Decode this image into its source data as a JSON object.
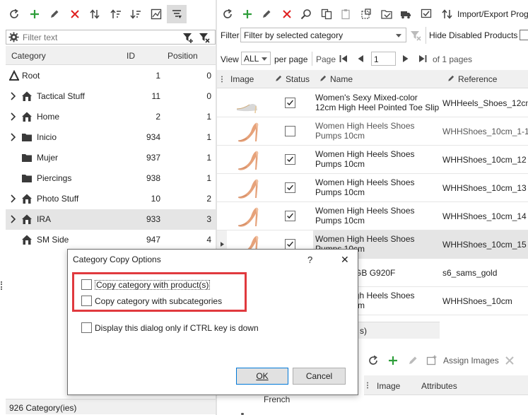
{
  "left_panel": {
    "filter_placeholder": "Filter text",
    "columns": {
      "category": "Category",
      "id": "ID",
      "position": "Position"
    },
    "rows": [
      {
        "name": "Root",
        "id": "1",
        "position": "0"
      },
      {
        "name": "Tactical Stuff",
        "id": "11",
        "position": "0"
      },
      {
        "name": "Home",
        "id": "2",
        "position": "1"
      },
      {
        "name": "Inicio",
        "id": "934",
        "position": "1"
      },
      {
        "name": "Mujer",
        "id": "937",
        "position": "1"
      },
      {
        "name": "Piercings",
        "id": "938",
        "position": "1"
      },
      {
        "name": "Photo Stuff",
        "id": "10",
        "position": "2"
      },
      {
        "name": "IRA",
        "id": "933",
        "position": "3"
      },
      {
        "name": "SM Side",
        "id": "947",
        "position": "4"
      }
    ],
    "status": "926 Category(ies)"
  },
  "right_toolbar": {
    "import_export_label": "Import/Export Prog"
  },
  "filter_bar": {
    "filter_label": "Filter",
    "filter_value": "Filter by selected category",
    "hide_disabled_label": "Hide Disabled Products"
  },
  "pager": {
    "view_label": "View",
    "view_value": "ALL",
    "per_page_label": "per page",
    "page_label": "Page",
    "page_value": "1",
    "of_pages": "of 1 pages"
  },
  "products": {
    "columns": {
      "image": "Image",
      "status": "Status",
      "name": "Name",
      "reference": "Reference"
    },
    "rows": [
      {
        "name": "Women's Sexy Mixed-color 12cm High Heel Pointed Toe Slip On",
        "reference": "WHHeels_Shoes_12cm",
        "checked": true
      },
      {
        "name": "Women High Heels Shoes Pumps 10cm",
        "reference": "WHHShoes_10cm_1-1",
        "checked": false
      },
      {
        "name": "Women High Heels Shoes Pumps 10cm",
        "reference": "WHHShoes_10cm_12",
        "checked": true
      },
      {
        "name": "Women High Heels Shoes Pumps 10cm",
        "reference": "WHHShoes_10cm_13",
        "checked": true
      },
      {
        "name": "Women High Heels Shoes Pumps 10cm",
        "reference": "WHHShoes_10cm_14",
        "checked": true
      },
      {
        "name": "Women High Heels Shoes Pumps 10cm",
        "reference": "WHHShoes_10cm_15",
        "checked": true
      },
      {
        "name": "laxy S6 32GB G920F",
        "reference": "s6_sams_gold",
        "checked": false
      },
      {
        "name": "Women High Heels Shoes Pumps 10cm",
        "reference": "WHHShoes_10cm",
        "checked": false
      }
    ],
    "count_partial": "s)"
  },
  "bottom_panel": {
    "assign_images_label": "Assign Images",
    "columns": {
      "image": "Image",
      "attributes": "Attributes"
    },
    "language": "French"
  },
  "dialog": {
    "title": "Category Copy Options",
    "help": "?",
    "close": "✕",
    "options": [
      {
        "label": "Copy category with product(s)"
      },
      {
        "label": "Copy category with subcategories"
      },
      {
        "label": "Display this dialog only if CTRL key is down"
      }
    ],
    "ok_label": "OK",
    "cancel_label": "Cancel"
  },
  "colors": {
    "accent_green": "#2e9e3a",
    "red": "#e02020",
    "highlight": "#e5e5e5",
    "dialog_highlight": "#e0393e"
  }
}
